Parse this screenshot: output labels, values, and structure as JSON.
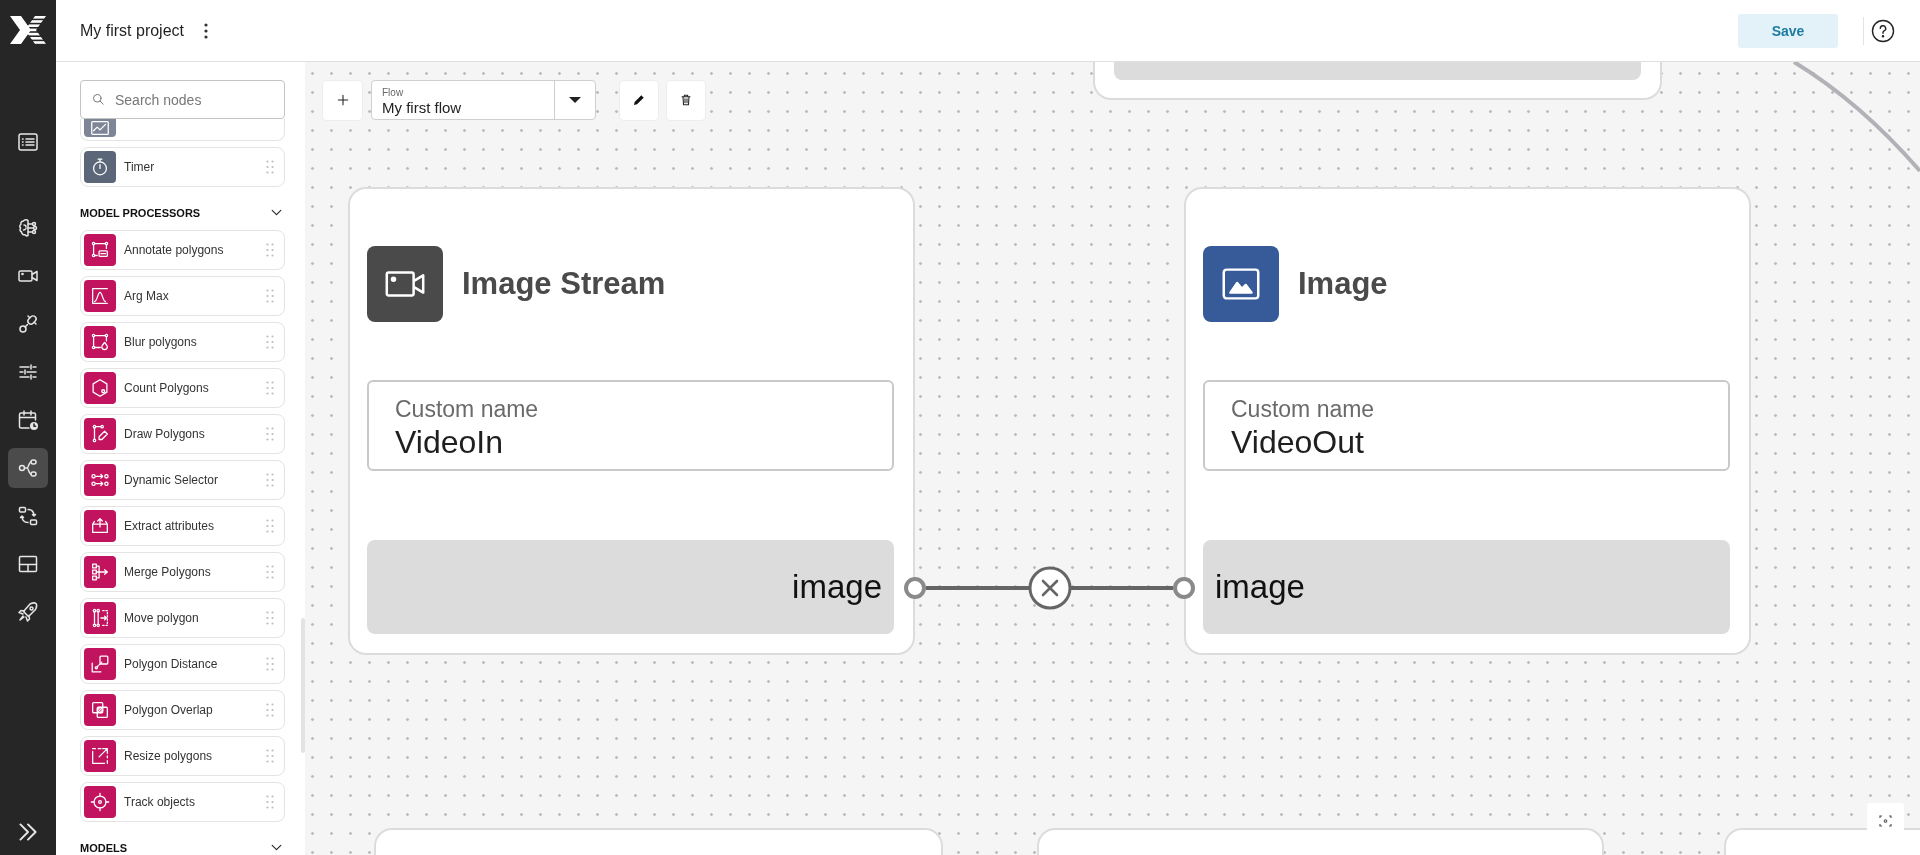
{
  "header": {
    "title": "My first project",
    "save_label": "Save"
  },
  "rail": {
    "groups": [
      {
        "items": [
          {
            "kind": "list",
            "selected": false
          }
        ]
      },
      {
        "items": [
          {
            "kind": "brain",
            "selected": false
          },
          {
            "kind": "camera",
            "selected": false
          },
          {
            "kind": "plug",
            "selected": false
          },
          {
            "kind": "sliders",
            "selected": false
          },
          {
            "kind": "calendar",
            "selected": false
          },
          {
            "kind": "flow",
            "selected": true
          },
          {
            "kind": "swap",
            "selected": false
          },
          {
            "kind": "layout",
            "selected": false
          },
          {
            "kind": "rocket",
            "selected": false
          }
        ]
      }
    ]
  },
  "sidebar": {
    "search": {
      "placeholder": "Search nodes"
    },
    "sections": [
      {
        "items": [
          {
            "kind": "chart",
            "color": "#7c8696"
          },
          {
            "kind": "timer",
            "label": "Timer",
            "color": "#5b6679"
          }
        ]
      },
      {
        "title": "MODEL PROCESSORS",
        "expanded": true,
        "items": [
          {
            "kind": "annotate",
            "label": "Annotate polygons",
            "color": "#c1135e"
          },
          {
            "kind": "argmax",
            "label": "Arg Max",
            "color": "#c1135e"
          },
          {
            "kind": "blur",
            "label": "Blur polygons",
            "color": "#c1135e"
          },
          {
            "kind": "count",
            "label": "Count Polygons",
            "color": "#c1135e"
          },
          {
            "kind": "draw",
            "label": "Draw Polygons",
            "color": "#c1135e"
          },
          {
            "kind": "selector",
            "label": "Dynamic Selector",
            "color": "#c1135e"
          },
          {
            "kind": "extract",
            "label": "Extract attributes",
            "color": "#c1135e"
          },
          {
            "kind": "merge",
            "label": "Merge Polygons",
            "color": "#c1135e"
          },
          {
            "kind": "move",
            "label": "Move polygon",
            "color": "#c1135e"
          },
          {
            "kind": "distance",
            "label": "Polygon Distance",
            "color": "#c1135e"
          },
          {
            "kind": "overlap",
            "label": "Polygon Overlap",
            "color": "#c1135e"
          },
          {
            "kind": "resize",
            "label": "Resize polygons",
            "color": "#c1135e"
          },
          {
            "kind": "track",
            "label": "Track objects",
            "color": "#c1135e"
          }
        ]
      },
      {
        "title": "MODELS",
        "expanded": true
      }
    ]
  },
  "canvas": {
    "flow_select": {
      "label": "Flow",
      "value": "My first flow"
    },
    "nodes": [
      {
        "kind": "partial-lower"
      },
      {
        "kind": "stream",
        "title": "Image Stream",
        "color": "#4a4a4a",
        "field": {
          "label": "Custom name",
          "value": "VideoIn"
        },
        "port": {
          "label": "image",
          "kind": "output",
          "connected": true
        }
      },
      {
        "kind": "image",
        "title": "Image",
        "color": "#375a99",
        "field": {
          "label": "Custom name",
          "value": "VideoOut"
        },
        "port": {
          "label": "image",
          "kind": "input",
          "connected": true
        }
      },
      {
        "kind": "partial-upper"
      },
      {
        "kind": "partial-upper"
      },
      {
        "kind": "partial-upper"
      }
    ]
  }
}
